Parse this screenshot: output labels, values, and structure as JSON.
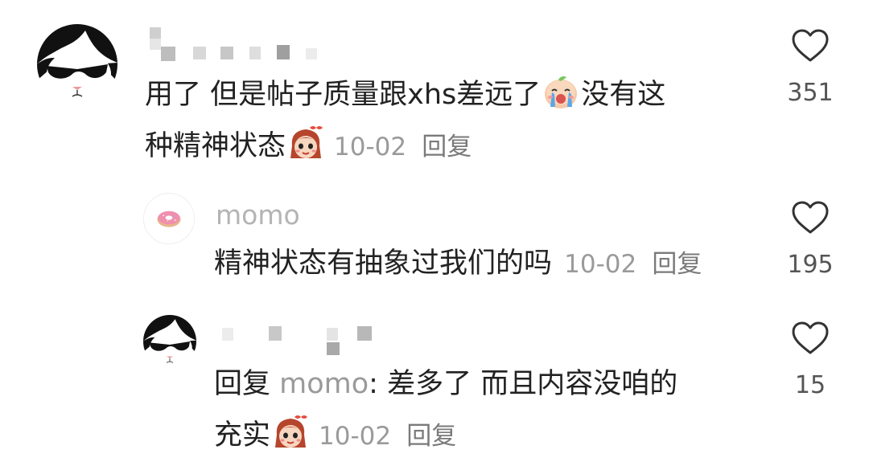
{
  "comments": [
    {
      "username": "",
      "text_line1_a": "用了 但是帖子质量跟xhs差远了",
      "text_line1_b": "没有这",
      "text_line2": "种精神状态",
      "emoji1": "crying-peach-emoji",
      "emoji2": "girl-face-emoji",
      "date": "10-02",
      "reply_label": "回复",
      "likes": "351",
      "avatar": "cat-with-sunglasses-avatar"
    },
    {
      "username": "momo",
      "text_line1": "精神状态有抽象过我们的吗",
      "date": "10-02",
      "reply_label": "回复",
      "likes": "195",
      "avatar": "donut-avatar"
    },
    {
      "username": "",
      "reply_prefix": "回复",
      "mention": "momo",
      "text_line1": ": 差多了 而且内容没咱的",
      "text_line2": "充实",
      "emoji1": "girl-face-emoji",
      "date": "10-02",
      "reply_label": "回复",
      "likes": "15",
      "avatar": "cat-with-sunglasses-avatar"
    }
  ],
  "colors": {
    "text": "#222222",
    "meta": "#9a9a9a",
    "username": "#b4b4b4",
    "heart_stroke": "#333333"
  }
}
